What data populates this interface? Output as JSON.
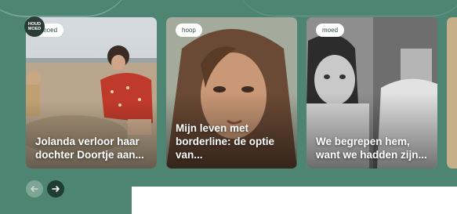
{
  "brand": {
    "logo_text": "HOUD MOED"
  },
  "cards": [
    {
      "tag": "moed",
      "title": "Jolanda verloor haar dochter Doortje aan..."
    },
    {
      "tag": "hoop",
      "title": "Mijn leven met borderline: de optie van..."
    },
    {
      "tag": "moed",
      "title": "We begrepen hem, want we hadden zijn..."
    }
  ],
  "nav": {
    "prev_icon": "arrow-left-icon",
    "next_icon": "arrow-right-icon"
  },
  "colors": {
    "band": "#4d8472",
    "nav_active": "#1f3d33"
  }
}
